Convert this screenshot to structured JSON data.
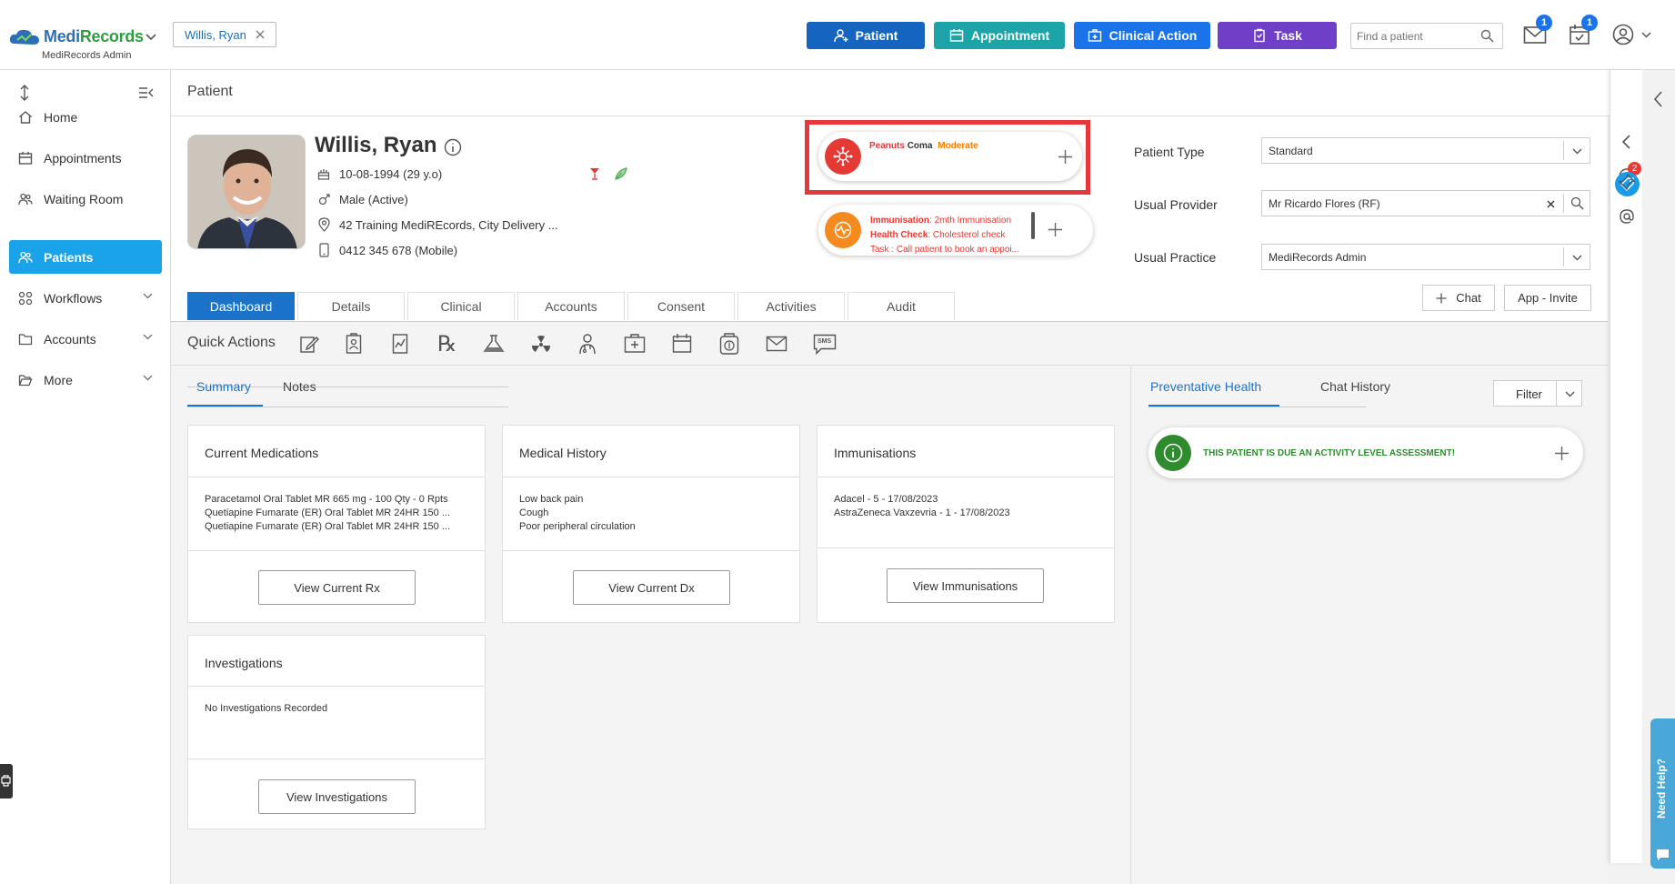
{
  "app": {
    "logo_part1": "Medi",
    "logo_part2": "Records",
    "org_name": "MediRecords Admin",
    "brand_color": "#2d6fb6"
  },
  "header": {
    "patient_chip": "Willis, Ryan",
    "buttons": {
      "patient": "Patient",
      "appointment": "Appointment",
      "clinical_action": "Clinical Action",
      "task": "Task"
    },
    "search_placeholder": "Find a patient",
    "mail_count": "1",
    "calendar_count": "1"
  },
  "sidebar": {
    "items": [
      {
        "label": "Home"
      },
      {
        "label": "Appointments"
      },
      {
        "label": "Waiting Room"
      },
      {
        "label": "Patients"
      },
      {
        "label": "Workflows"
      },
      {
        "label": "Accounts"
      },
      {
        "label": "More"
      }
    ]
  },
  "page": {
    "title": "Patient"
  },
  "patient": {
    "name": "Willis, Ryan",
    "dob": "10-08-1994 (29 y.o)",
    "gender": "Male (Active)",
    "address": "42 Training MediREcords, City Delivery ...",
    "phone": "0412 345 678 (Mobile)"
  },
  "alerts": {
    "allergy": {
      "substance": "Peanuts",
      "reaction": "Coma",
      "severity": "Moderate"
    },
    "reminders": {
      "imm_label": "Immunisation",
      "imm_value": ": 2mth Immunisation",
      "health_label": "Health Check",
      "health_value": ": Cholesterol check",
      "task_text": "Task : Call patient to book an appoi..."
    }
  },
  "profile_fields": {
    "patient_type_label": "Patient Type",
    "patient_type_value": "Standard",
    "provider_label": "Usual Provider",
    "provider_value": "Mr Ricardo Flores (RF)",
    "practice_label": "Usual Practice",
    "practice_value": "MediRecords Admin",
    "chat_button": "Chat",
    "app_invite_button": "App - Invite"
  },
  "tabs": [
    "Dashboard",
    "Details",
    "Clinical",
    "Accounts",
    "Consent",
    "Activities",
    "Audit"
  ],
  "quick_actions": {
    "label": "Quick Actions",
    "sms_label": "SMS"
  },
  "subtabs": {
    "summary": "Summary",
    "notes": "Notes"
  },
  "cards": {
    "medications": {
      "title": "Current Medications",
      "lines": [
        "Paracetamol Oral Tablet MR 665 mg - 100 Qty - 0 Rpts",
        "Quetiapine Fumarate (ER) Oral Tablet MR 24HR 150 ...",
        "Quetiapine Fumarate (ER) Oral Tablet MR 24HR 150 ..."
      ],
      "button": "View Current Rx"
    },
    "history": {
      "title": "Medical History",
      "lines": [
        "Low back pain",
        "Cough",
        "Poor peripheral circulation"
      ],
      "button": "View Current Dx"
    },
    "immunisations": {
      "title": "Immunisations",
      "lines": [
        "Adacel - 5 - 17/08/2023",
        "AstraZeneca Vaxzevria - 1 - 17/08/2023"
      ],
      "button": "View Immunisations"
    },
    "investigations": {
      "title": "Investigations",
      "lines": [
        "No Investigations Recorded"
      ],
      "button": "View Investigations"
    }
  },
  "right_panel": {
    "tab_preventative": "Preventative Health",
    "tab_chat": "Chat History",
    "filter_button": "Filter",
    "assessment_alert": "THIS PATIENT IS DUE AN ACTIVITY LEVEL ASSESSMENT!"
  },
  "right_rail": {
    "notification_count": "2",
    "need_help": "Need Help?"
  }
}
